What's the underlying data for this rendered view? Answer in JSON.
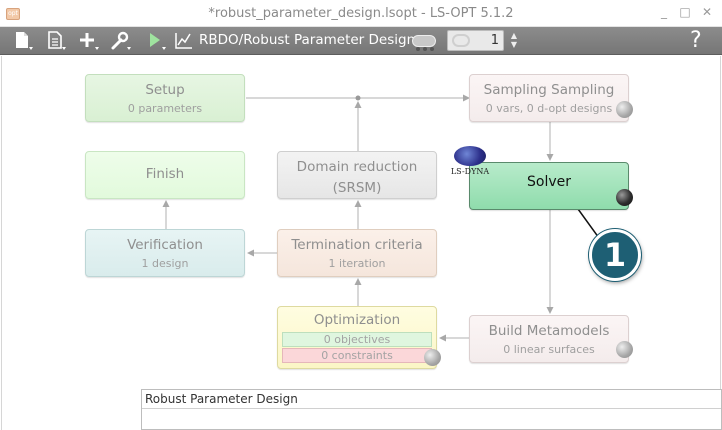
{
  "window": {
    "title": "*robust_parameter_design.lsopt - LS-OPT 5.1.2",
    "app_icon_text": "opt",
    "minimize": "_",
    "maximize": "□",
    "close": "✕"
  },
  "toolbar": {
    "mode_label": "RBDO/Robust Parameter Design",
    "iterations_value": "1",
    "help_label": "?",
    "icons": [
      "new-file-icon",
      "file-menu-icon",
      "add-icon",
      "wrench-icon",
      "run-icon",
      "chart-icon"
    ]
  },
  "flow": {
    "setup": {
      "title": "Setup",
      "sub": "0 parameters"
    },
    "finish": {
      "title": "Finish"
    },
    "verification": {
      "title": "Verification",
      "sub": "1 design"
    },
    "domain_reduction": {
      "title_line1": "Domain reduction",
      "title_line2": "(SRSM)"
    },
    "termination": {
      "title": "Termination criteria",
      "sub": "1 iteration"
    },
    "optimization": {
      "title": "Optimization",
      "objectives": "0 objectives",
      "constraints": "0 constraints"
    },
    "sampling": {
      "title": "Sampling Sampling",
      "sub": "0 vars, 0 d-opt designs"
    },
    "solver": {
      "title": "Solver",
      "logo_text": "LS-DYNA"
    },
    "metamodels": {
      "title": "Build Metamodels",
      "sub": "0 linear surfaces"
    }
  },
  "callout": {
    "number": "1"
  },
  "bottom_panel": {
    "title": "Robust Parameter Design"
  },
  "colors": {
    "toolbar": "#808080",
    "solver_fill": "#a3e3bb",
    "callout": "#1e5f74"
  }
}
